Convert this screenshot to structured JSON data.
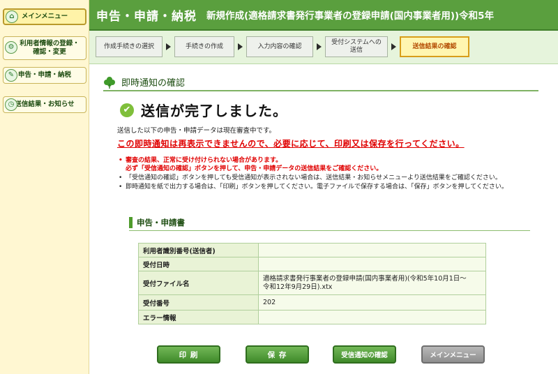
{
  "sidebar": {
    "items": [
      {
        "label": "メインメニュー",
        "icon": "home-icon"
      },
      {
        "label": "利用者情報の登録・\n確認・変更",
        "icon": "user-settings-icon"
      },
      {
        "label": "申告・申請・納税",
        "icon": "document-icon"
      },
      {
        "label": "送信結果・お知らせ",
        "icon": "clock-icon"
      }
    ]
  },
  "header": {
    "title": "申告・申請・納税",
    "subtitle": "新規作成(適格請求書発行事業者の登録申請(国内事業者用))令和5年"
  },
  "steps": [
    {
      "label": "作成手続きの選択",
      "active": false
    },
    {
      "label": "手続きの作成",
      "active": false
    },
    {
      "label": "入力内容の確認",
      "active": false
    },
    {
      "label": "受付システムへの\n送信",
      "active": false
    },
    {
      "label": "送信結果の確認",
      "active": true
    }
  ],
  "main": {
    "section_title": "即時通知の確認",
    "complete_message": "送信が完了しました。",
    "under_review": "送信した以下の申告・申請データは現在審査中です。",
    "warning": "この即時通知は再表示できませんので、必要に応じて、印刷又は保存を行ってください。",
    "notes": [
      {
        "text": "審査の結果、正常に受け付けられない場合があります。\n必ず「受信通知の確認」ボタンを押して、申告・申請データの送信結果をご確認ください。",
        "highlight": true
      },
      {
        "text": "「受信通知の確認」ボタンを押しても受信通知が表示されない場合は、送信結果・お知らせメニューより送信結果をご確認ください。",
        "highlight": false
      },
      {
        "text": "即時通知を紙で出力する場合は、「印刷」ボタンを押してください。電子ファイルで保存する場合は、「保存」ボタンを押してください。",
        "highlight": false
      }
    ],
    "table_title": "申告・申請書",
    "table": [
      {
        "key": "利用者識別番号(送信者)",
        "value": ""
      },
      {
        "key": "受付日時",
        "value": ""
      },
      {
        "key": "受付ファイル名",
        "value": "適格請求書発行事業者の登録申請(国内事業者用)(令和5年10月1日～\n令和12年9月29日).xtx"
      },
      {
        "key": "受付番号",
        "value": "202"
      },
      {
        "key": "エラー情報",
        "value": ""
      }
    ]
  },
  "buttons": {
    "print": "印 刷",
    "save": "保 存",
    "receipt": "受信通知の確認",
    "main_menu": "メインメニュー"
  },
  "colors": {
    "header_green": "#5a9f3e",
    "sidebar_bg": "#fff7d2",
    "warning_red": "#e00000",
    "active_step_text": "#b34a00"
  }
}
